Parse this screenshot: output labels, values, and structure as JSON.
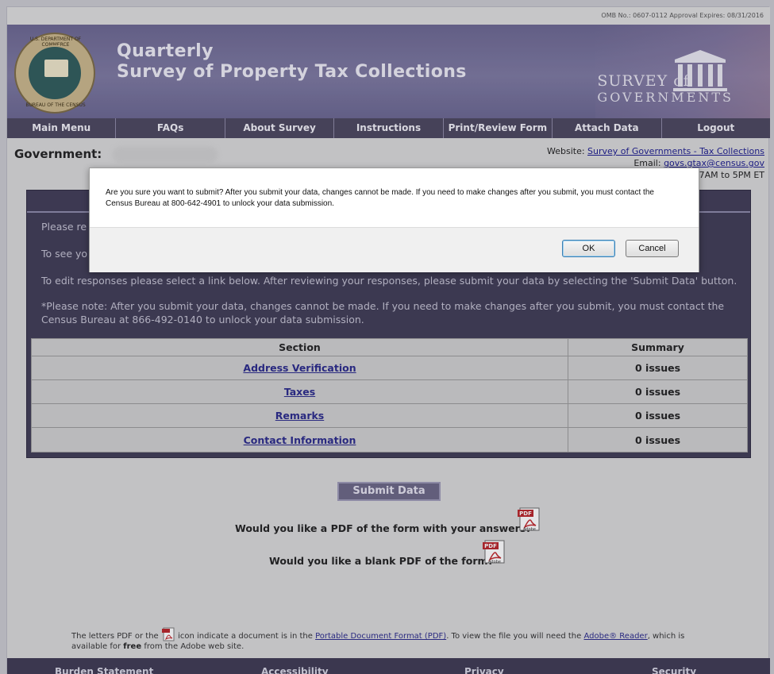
{
  "omb_text": "OMB No.: 0607-0112 Approval Expires: 08/31/2016",
  "header": {
    "title_line1": "Quarterly",
    "title_line2": "Survey of Property Tax Collections",
    "seal_top_text": "U.S. DEPARTMENT OF COMMERCE",
    "seal_bottom_text": "BUREAU OF THE CENSUS",
    "logo_line1": "SURVEY of",
    "logo_line2": "GOVERNMENTS"
  },
  "nav": [
    "Main Menu",
    "FAQs",
    "About Survey",
    "Instructions",
    "Print/Review Form",
    "Attach Data",
    "Logout"
  ],
  "government_label": "Government:",
  "contact": {
    "website_label": "Website:",
    "website_link": "Survey of Governments - Tax Collections",
    "email_label": "Email:",
    "email_link": "govs.gtax@census.gov",
    "hours": "7AM to 5PM ET"
  },
  "panel": {
    "p1": "Please re",
    "p2": "To see yo",
    "p3": "To edit responses please select a link below. After reviewing your responses, please submit your data by selecting the 'Submit Data' button.",
    "p4": "*Please note: After you submit your data, changes cannot be made. If you need to make changes after you submit, you must contact the Census Bureau at 866-492-0140 to unlock your data submission."
  },
  "table": {
    "headers": [
      "Section",
      "Summary"
    ],
    "rows": [
      {
        "section": "Address Verification",
        "summary": "0 issues"
      },
      {
        "section": "Taxes",
        "summary": "0 issues"
      },
      {
        "section": "Remarks",
        "summary": "0 issues"
      },
      {
        "section": "Contact Information",
        "summary": "0 issues"
      }
    ]
  },
  "submit_label": "Submit Data",
  "pdf_question_answers": "Would you like a PDF of the form with your answers?",
  "pdf_question_blank": "Would you like a blank PDF of the form?",
  "pdf_icon_label": "PDF",
  "pdf_icon_sublabel": "Adobe",
  "pdf_note": {
    "t1": "The letters PDF or the",
    "t2": "icon indicate a document is in the",
    "link1": "Portable Document Format (PDF)",
    "t3": ". To view the file you will need the",
    "link2": "Adobe® Reader",
    "t4": ", which is available for",
    "bold": "free",
    "t5": "from the Adobe web site."
  },
  "footer": [
    "Burden Statement",
    "Accessibility",
    "Privacy",
    "Security"
  ],
  "dialog": {
    "message": "Are you sure you want to submit? After you submit your data, changes cannot be made. If you need to make changes after you submit, you must contact the Census Bureau at 800-642-4901 to unlock your data submission.",
    "ok": "OK",
    "cancel": "Cancel"
  }
}
